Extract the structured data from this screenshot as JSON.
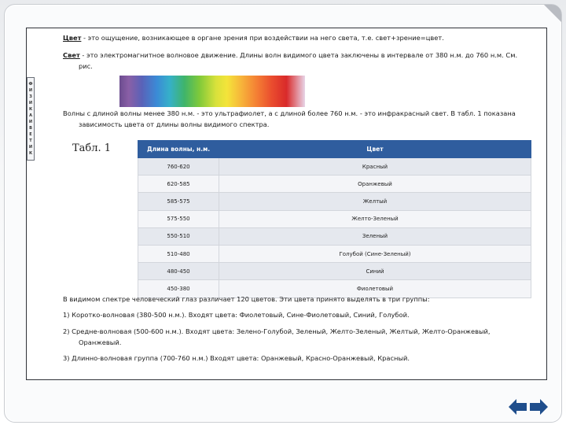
{
  "side_label": [
    "Ф",
    "И",
    "З",
    "И",
    "К",
    "А",
    "И",
    "В",
    "Е",
    "Т",
    "И",
    "К"
  ],
  "paragraphs": {
    "p1_term": "Цвет",
    "p1_text": " - это ощущение, возникающее в органе зрения при воздействии на него света, т.е. свет+зрение=цвет.",
    "p2_term": "Свет",
    "p2_text": " - это электромагнитное волновое движение. Длины волн видимого цвета заключены в интервале от 380 н.м. до 760 н.м. См.",
    "p2_cont": "рис.",
    "p3_text": "Волны с длиной волны менее 380 н.м. - это ультрафиолет, а с длиной более 760 н.м. - это инфракрасный свет. В табл. 1 показана",
    "p3_cont": "зависимость цвета от длины волны видимого спектра."
  },
  "table": {
    "label": "Табл. 1",
    "headers": [
      "Длина волны, н.м.",
      "Цвет"
    ],
    "rows": [
      [
        "760-620",
        "Красный"
      ],
      [
        "620-585",
        "Оранжевый"
      ],
      [
        "585-575",
        "Желтый"
      ],
      [
        "575-550",
        "Желто-Зеленый"
      ],
      [
        "550-510",
        "Зеленый"
      ],
      [
        "510-480",
        "Голубой (Сине-Зеленый)"
      ],
      [
        "480-450",
        "Синий"
      ],
      [
        "450-380",
        "Фиолетовый"
      ]
    ]
  },
  "bottom": {
    "intro": "В видимом спектре человеческий глаз различает 120 цветов. Эти цвета принято выделять в три группы:",
    "g1": "1) Коротко-волновая (380-500 н.м.). Входят цвета: Фиолетовый, Сине-Фиолетовый, Синий, Голубой.",
    "g2": "2) Средне-волновая (500-600 н.м.). Входят цвета: Зелено-Голубой, Зеленый, Желто-Зеленый, Желтый, Желто-Оранжевый,",
    "g2_cont": "Оранжевый.",
    "g3": "3) Длинно-волновая группа (700-760 н.м.) Входят цвета: Оранжевый, Красно-Оранжевый, Красный."
  },
  "colors": {
    "header_bg": "#2f5d9e",
    "nav_arrow": "#1f4e8c"
  },
  "icons": [
    "arrow-left-icon",
    "arrow-right-icon"
  ]
}
